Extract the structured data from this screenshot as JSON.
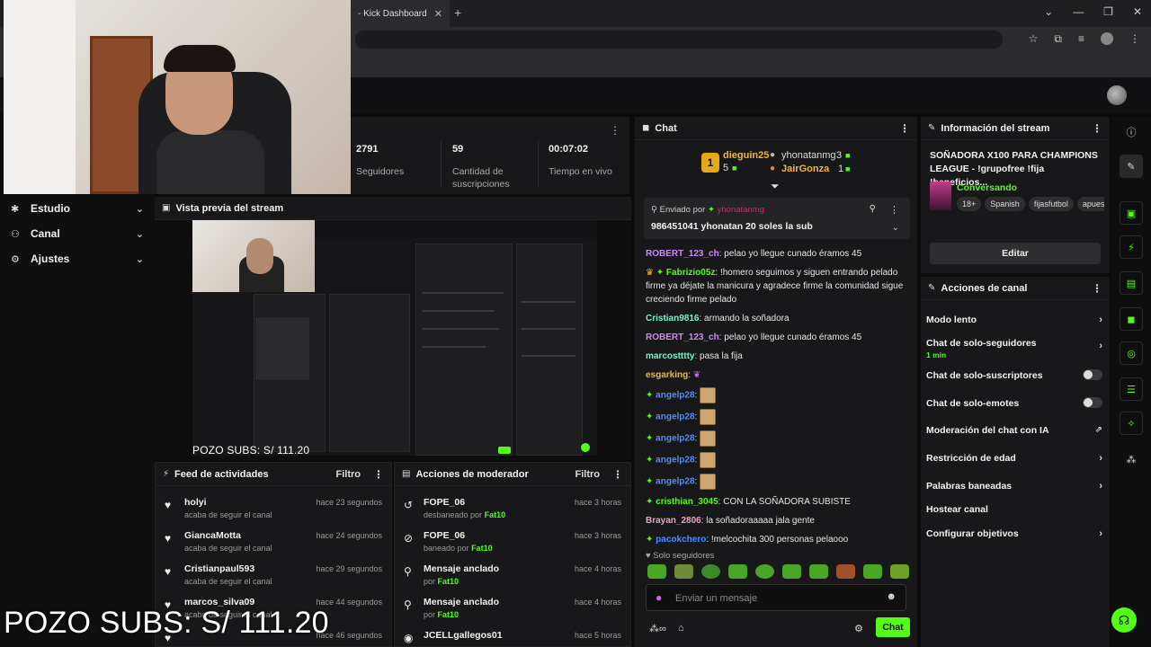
{
  "browser": {
    "tab_title": "- Kick Dashboard",
    "tab_close": "✕",
    "new_tab": "+"
  },
  "overlay": {
    "pozo_text": "POZO SUBS: S/ 111.20",
    "pozo_preview": "POZO SUBS: S/ 111.20"
  },
  "left_nav": [
    {
      "icon": "studio-icon",
      "label": "Estudio"
    },
    {
      "icon": "channel-icon",
      "label": "Canal"
    },
    {
      "icon": "gear-icon",
      "label": "Ajustes"
    }
  ],
  "stats": {
    "followers_value": "2791",
    "followers_label": "Seguidores",
    "subs_value": "59",
    "subs_label": "Cantidad de suscripciones",
    "live_value": "00:07:02",
    "live_label": "Tiempo en vivo"
  },
  "preview": {
    "title": "Vista previa del stream"
  },
  "feed": {
    "title": "Feed de actividades",
    "filter": "Filtro",
    "items": [
      {
        "user": "holyi",
        "action": "acaba de seguir el canal",
        "time": "hace 23 segundos"
      },
      {
        "user": "GiancaMotta",
        "action": "acaba de seguir el canal",
        "time": "hace 24 segundos"
      },
      {
        "user": "Cristianpaul593",
        "action": "acaba de seguir el canal",
        "time": "hace 29 segundos"
      },
      {
        "user": "marcos_silva09",
        "action": "acaba de seguir el canal",
        "time": "hace 44 segundos"
      },
      {
        "user": "",
        "action": "",
        "time": "hace 46 segundos"
      }
    ]
  },
  "mod": {
    "title": "Acciones de moderador",
    "filter": "Filtro",
    "items": [
      {
        "icon": "undo-icon",
        "title": "FOPE_06",
        "prefix": "desbaneado por",
        "by": "Fat10",
        "time": "hace 3 horas"
      },
      {
        "icon": "ban-icon",
        "title": "FOPE_06",
        "prefix": "baneado por",
        "by": "Fat10",
        "time": "hace 3 horas"
      },
      {
        "icon": "pin-icon",
        "title": "Mensaje anclado",
        "prefix": "por",
        "by": "Fat10",
        "time": "hace 4 horas"
      },
      {
        "icon": "pin-icon",
        "title": "Mensaje anclado",
        "prefix": "por",
        "by": "Fat10",
        "time": "hace 4 horas"
      },
      {
        "icon": "user-icon",
        "title": "JCELLgallegos01",
        "prefix": "",
        "by": "",
        "time": "hace 5 horas"
      }
    ]
  },
  "chat": {
    "title": "Chat",
    "gifters": {
      "rank": "1",
      "first_name": "dieguin25",
      "first_count": "5",
      "second_name": "yhonatanmg",
      "second_count": "3",
      "third_name": "JairGonza",
      "third_count": "1"
    },
    "pinned": {
      "sent_by": "Enviado por",
      "user": "yhonatanmg",
      "message": "986451041 yhonatan 20 soles la sub"
    },
    "messages": [
      {
        "user": "ROBERT_123_ch",
        "color": "#c98cf2",
        "text": "pelao yo llegue cunado éramos 45"
      },
      {
        "user": "Fabrizio05z",
        "color": "#53fc18",
        "text": "!homero seguimos y siguen entrando pelado firme ya déjate la manicura y agradece firme la comunidad sigue creciendo firme pelado"
      },
      {
        "user": "Cristian9816",
        "color": "#7df2c5",
        "text": "armando la soñadora"
      },
      {
        "user": "ROBERT_123_ch",
        "color": "#c98cf2",
        "text": "pelao yo llegue cunado éramos 45"
      },
      {
        "user": "marcostttty",
        "color": "#7df2c5",
        "text": "pasa la fija"
      },
      {
        "user": "esgarking",
        "color": "#f5b342",
        "text": ""
      },
      {
        "user": "angelp28",
        "color": "#4d8cff",
        "text": ""
      },
      {
        "user": "angelp28",
        "color": "#4d8cff",
        "text": ""
      },
      {
        "user": "angelp28",
        "color": "#4d8cff",
        "text": ""
      },
      {
        "user": "angelp28",
        "color": "#4d8cff",
        "text": ""
      },
      {
        "user": "angelp28",
        "color": "#4d8cff",
        "text": ""
      },
      {
        "user": "cristhian_3045",
        "color": "#53fc18",
        "text": "CON LA SOÑADORA SUBISTE"
      },
      {
        "user": "Brayan_2806",
        "color": "#f2a2c0",
        "text": "la soñadoraaaaa jala gente"
      },
      {
        "user": "pacokchero",
        "color": "#4d8cff",
        "text": "!melcochita 300 personas pelaooo"
      }
    ],
    "followers_only": "Solo seguidores",
    "input_placeholder": "Enviar un mensaje",
    "send_label": "Chat"
  },
  "stream_info": {
    "title": "Información del stream",
    "stream_title": "SOÑADORA X100 PARA CHAMPIONS LEAGUE - !grupofree !fija !beneficios...",
    "category": "Conversando",
    "tags": [
      "18+",
      "Spanish",
      "fijasfutbol",
      "apues"
    ],
    "edit": "Editar"
  },
  "channel_actions": {
    "title": "Acciones de canal",
    "items": [
      {
        "label": "Modo lento",
        "sub": "",
        "control": "chevron"
      },
      {
        "label": "Chat de solo-seguidores",
        "sub": "1 min",
        "control": "chevron"
      },
      {
        "label": "Chat de solo-suscriptores",
        "sub": "",
        "control": "toggle"
      },
      {
        "label": "Chat de solo-emotes",
        "sub": "",
        "control": "toggle"
      },
      {
        "label": "Moderación del chat con IA",
        "sub": "",
        "control": "external"
      },
      {
        "label": "Restricción de edad",
        "sub": "",
        "control": "chevron"
      },
      {
        "label": "Palabras baneadas",
        "sub": "",
        "control": "chevron"
      },
      {
        "label": "Hostear canal",
        "sub": "",
        "control": "none"
      },
      {
        "label": "Configurar objetivos",
        "sub": "",
        "control": "chevron"
      }
    ]
  },
  "colors": {
    "accent": "#53fc18",
    "panel": "#18181a",
    "background": "#0b0b0c"
  }
}
